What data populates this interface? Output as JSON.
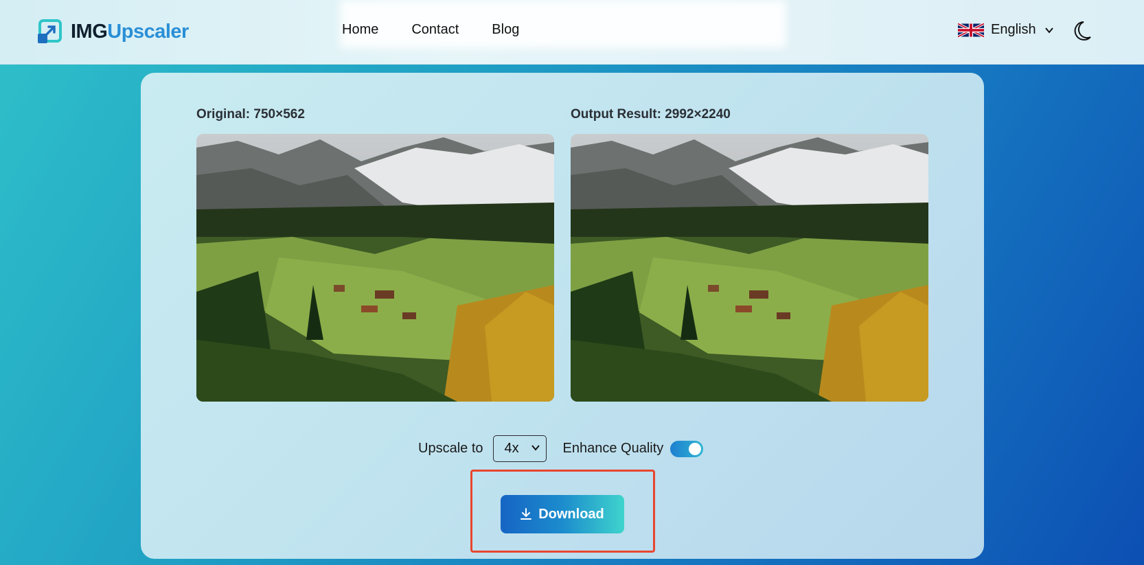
{
  "header": {
    "logo": {
      "part1": "IMG",
      "part2": "Upscaler"
    },
    "nav": [
      {
        "label": "Home"
      },
      {
        "label": "Contact"
      },
      {
        "label": "Blog"
      }
    ],
    "language": {
      "label": "English",
      "flag_icon": "uk-flag-icon"
    },
    "theme_icon": "moon-icon"
  },
  "comparison": {
    "original_label": "Original: 750×562",
    "output_label": "Output Result: 2992×2240"
  },
  "controls": {
    "upscale_label": "Upscale to",
    "upscale_value": "4x",
    "enhance_label": "Enhance Quality",
    "enhance_on": true
  },
  "actions": {
    "download_label": "Download",
    "download_icon": "download-icon"
  },
  "colors": {
    "accent": "#1f8fd0",
    "highlight": "#e8462f",
    "logo_blue": "#2a8fd6"
  }
}
